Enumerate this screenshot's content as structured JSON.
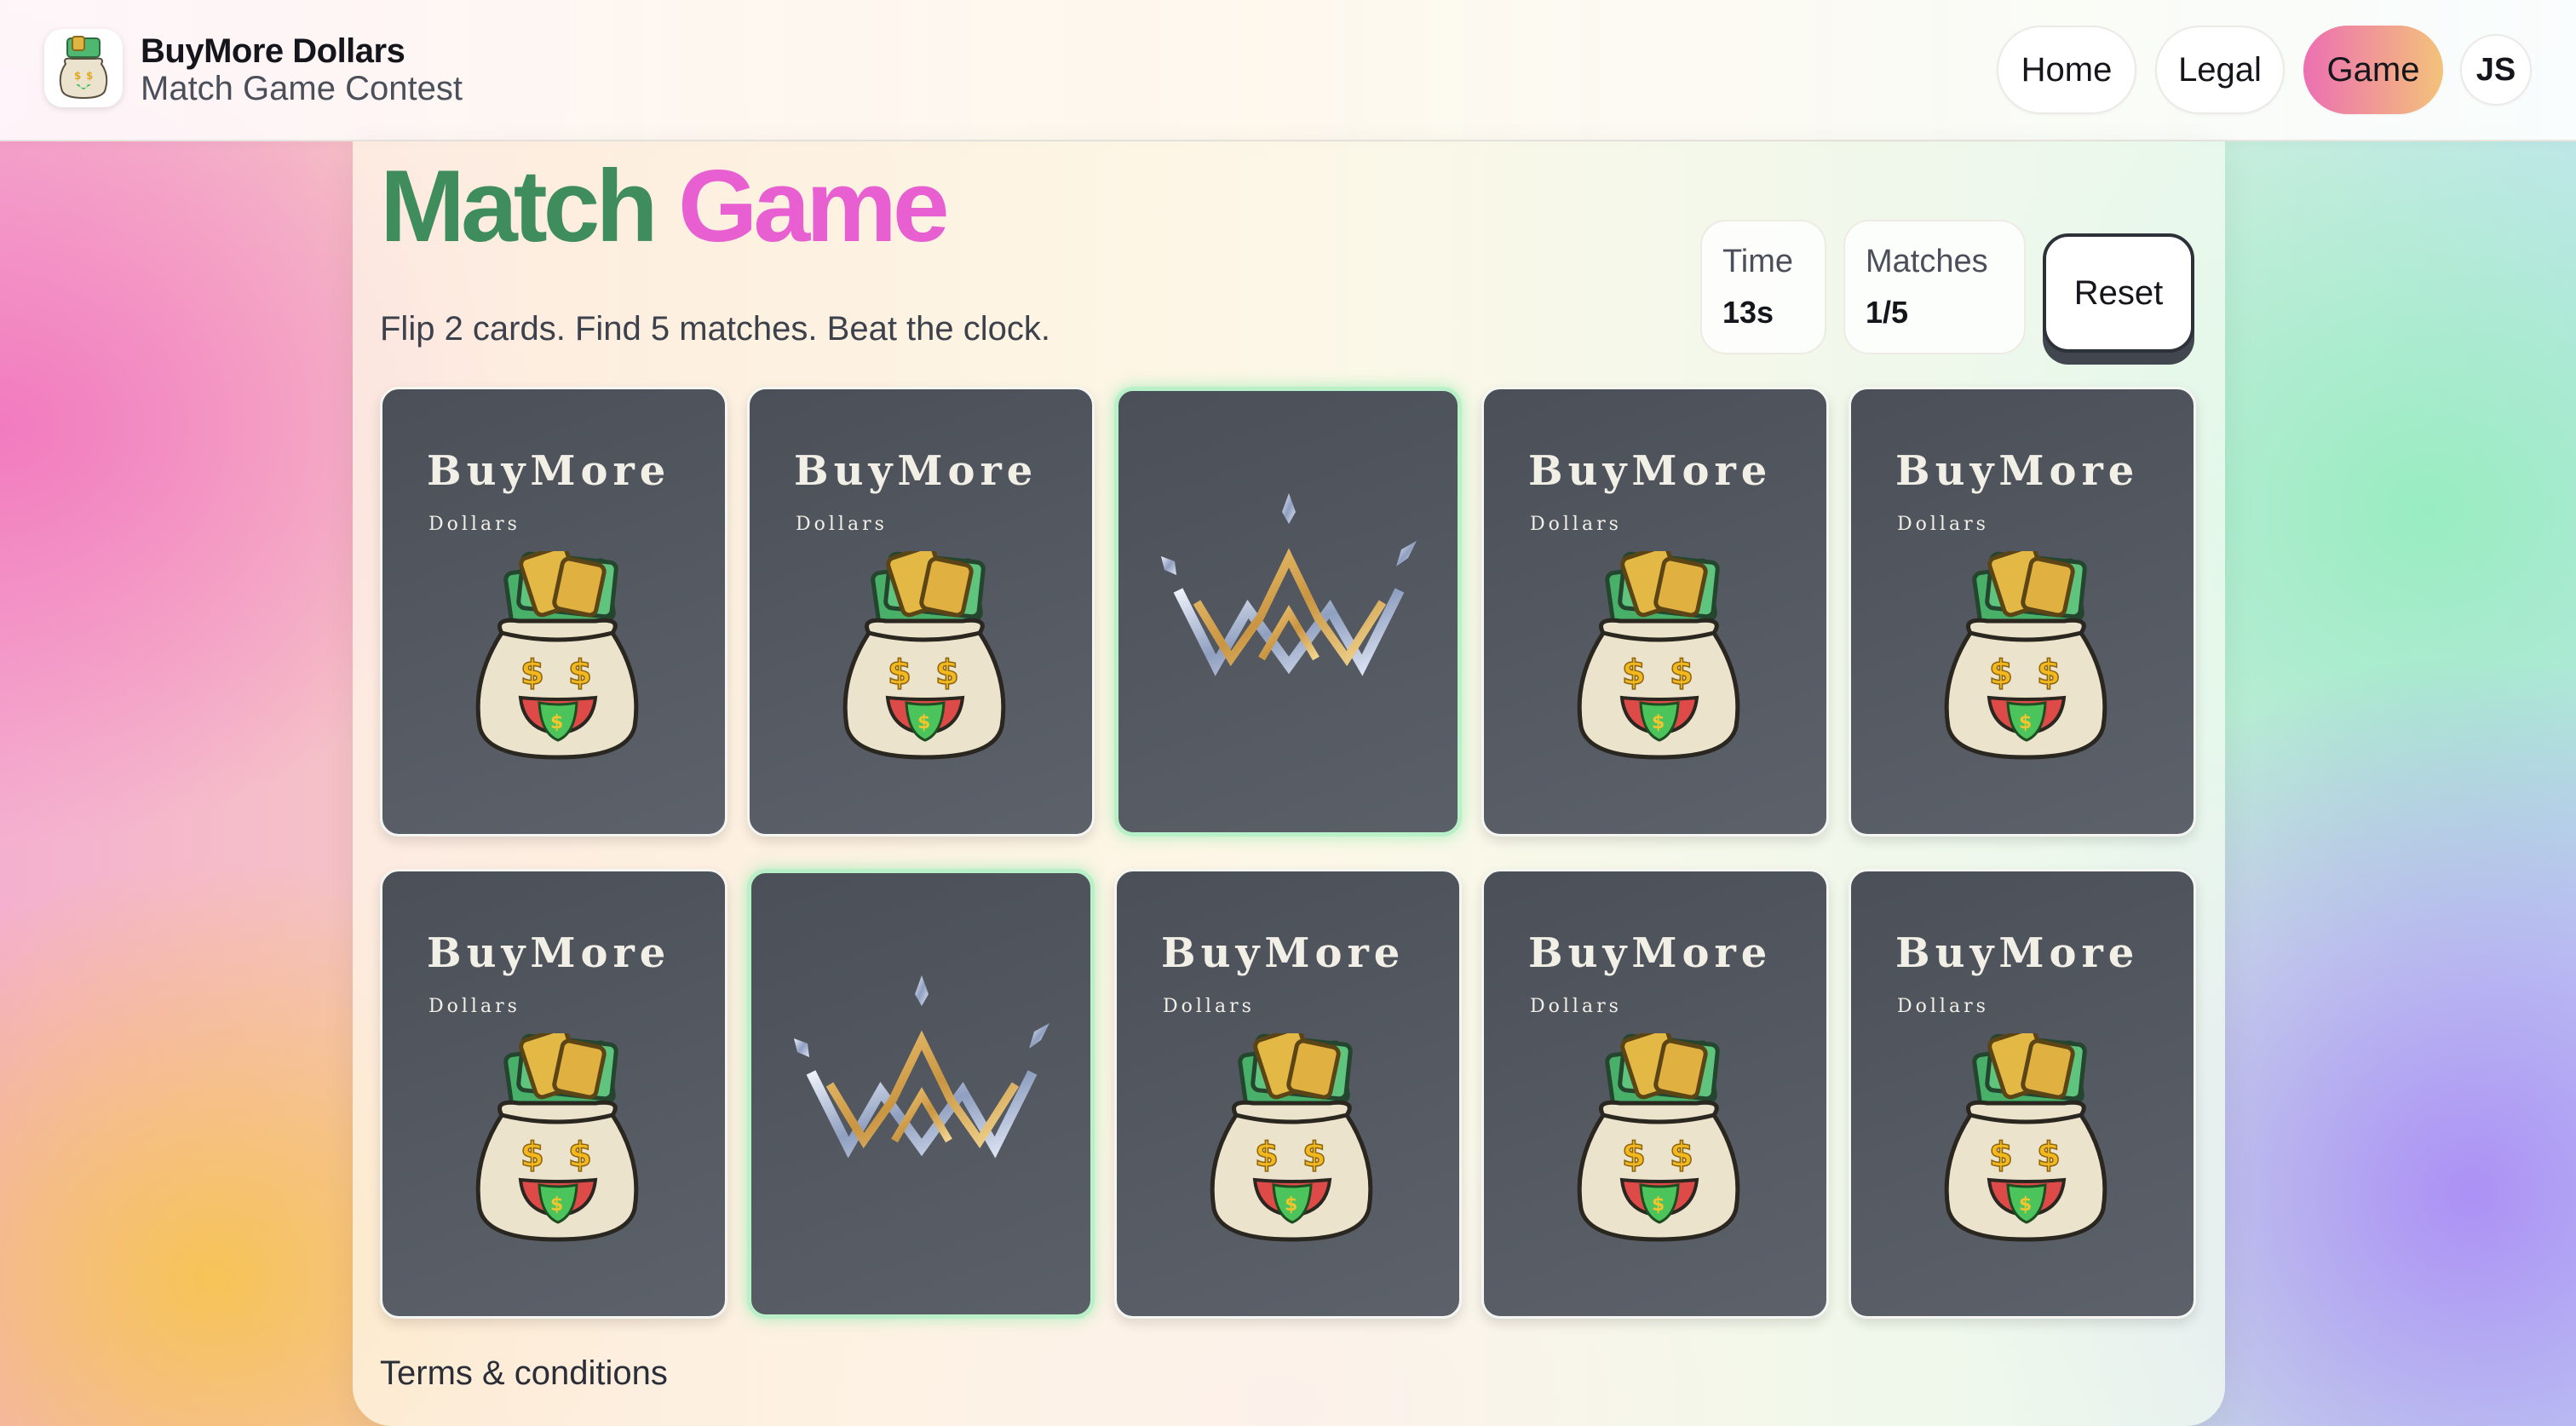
{
  "app": {
    "title": "BuyMore Dollars",
    "subtitle": "Match Game Contest"
  },
  "nav": {
    "items": [
      {
        "label": "Home",
        "active": false
      },
      {
        "label": "Legal",
        "active": false
      },
      {
        "label": "Game",
        "active": true
      }
    ],
    "avatar_initials": "JS"
  },
  "game": {
    "title_part1": "Match",
    "title_part2": "Game",
    "instructions": "Flip 2 cards. Find 5 matches. Beat the clock.",
    "time_label": "Time",
    "time_value": "13s",
    "matches_label": "Matches",
    "matches_value": "1/5",
    "reset_label": "Reset"
  },
  "card_back": {
    "brand": "BuyMore",
    "brand_sub": "Dollars",
    "icon": "money-bag-icon"
  },
  "cards": [
    {
      "state": "face-down"
    },
    {
      "state": "face-down"
    },
    {
      "state": "matched",
      "face": "crown-icon"
    },
    {
      "state": "face-down"
    },
    {
      "state": "face-down"
    },
    {
      "state": "face-down"
    },
    {
      "state": "matched",
      "face": "crown-icon"
    },
    {
      "state": "face-down"
    },
    {
      "state": "face-down"
    },
    {
      "state": "face-down"
    }
  ],
  "footer": {
    "terms_label": "Terms & conditions"
  },
  "colors": {
    "title_green": "#3f8d5c",
    "title_pink": "#e85fd2",
    "card_bg": "#50555d",
    "matched_border": "#b9f0c8",
    "active_nav_gradient": [
      "#ec6fb2",
      "#f3c37a"
    ]
  }
}
